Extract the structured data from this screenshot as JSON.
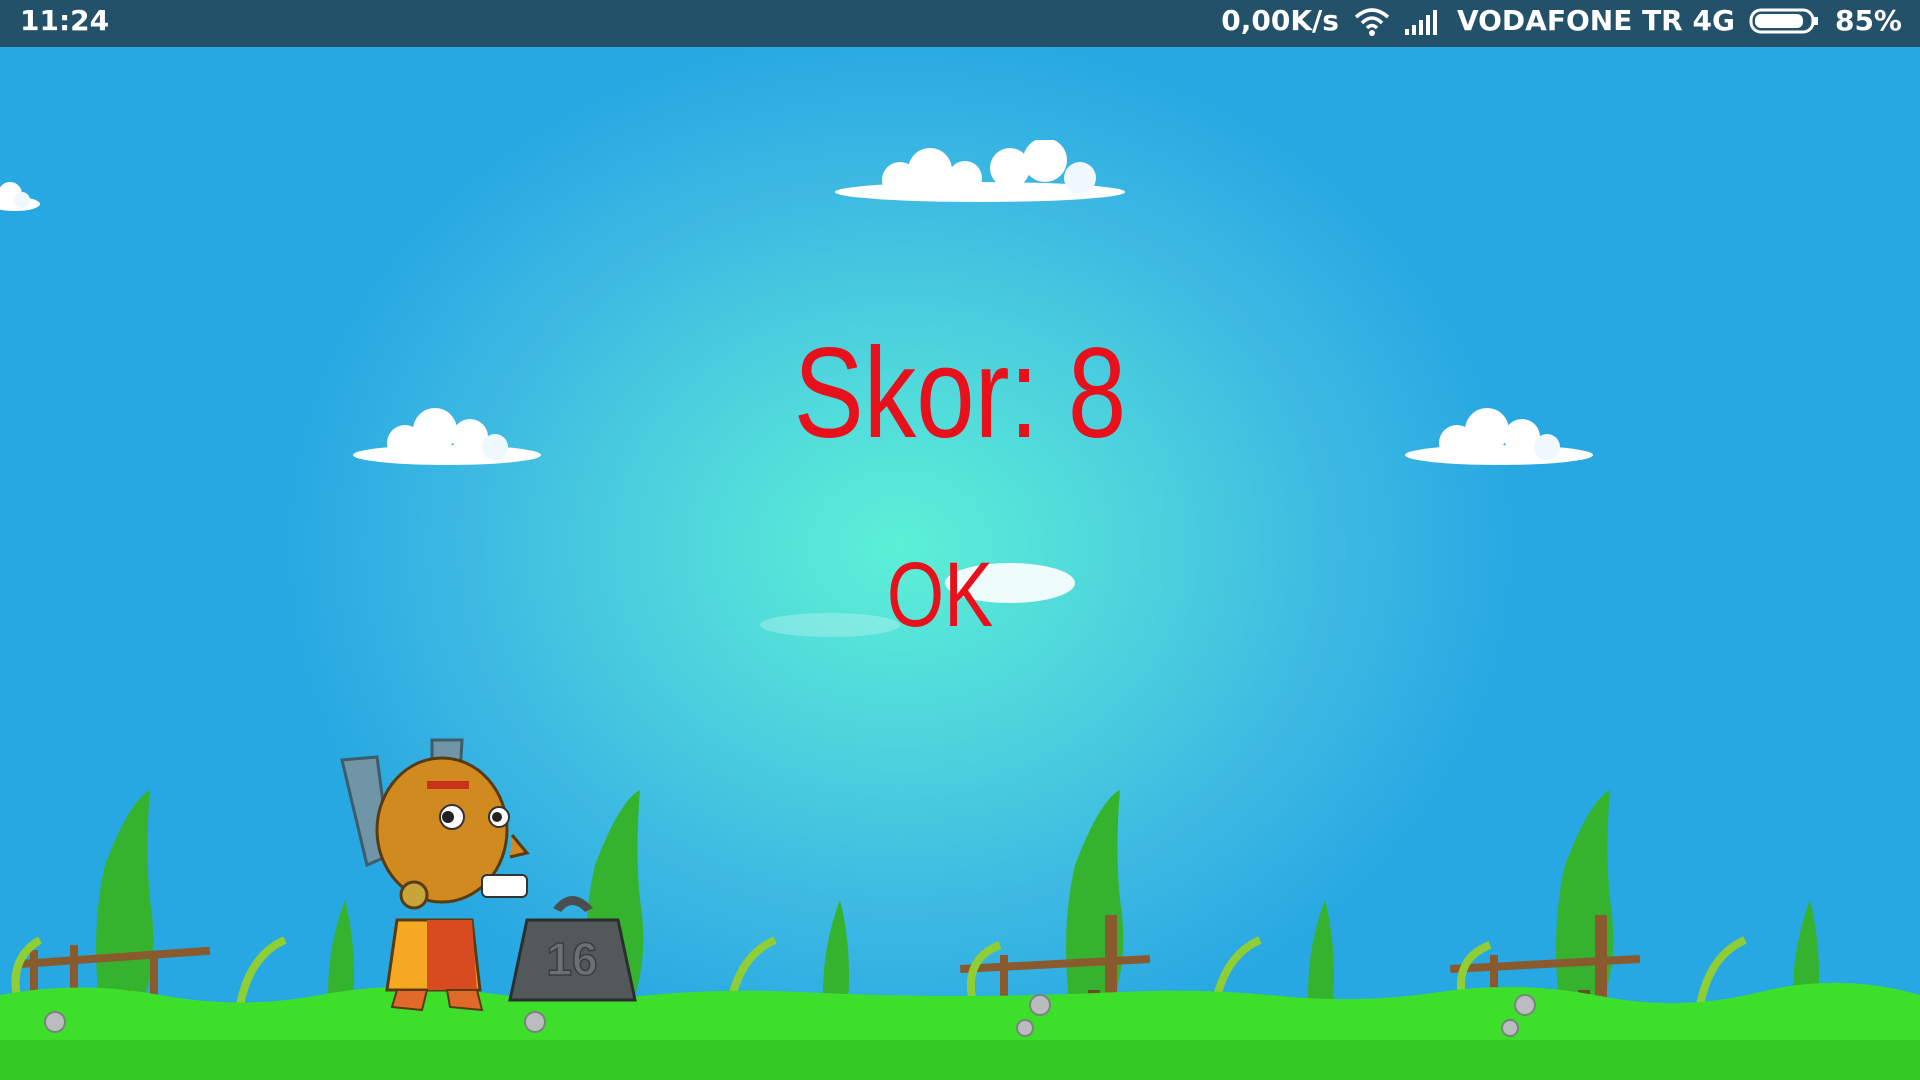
{
  "status_bar": {
    "time": "11:24",
    "net_speed": "0,00K/s",
    "carrier": "VODAFONE TR 4G",
    "battery_pct": "85%"
  },
  "game": {
    "score_text": "Skor: 8",
    "ok_label": "OK",
    "weight_label": "16"
  },
  "colors": {
    "score_red": "#e8101a",
    "sky_center": "#5cf0d6",
    "sky_edge": "#27a8e2",
    "grass": "#3edf2a"
  }
}
